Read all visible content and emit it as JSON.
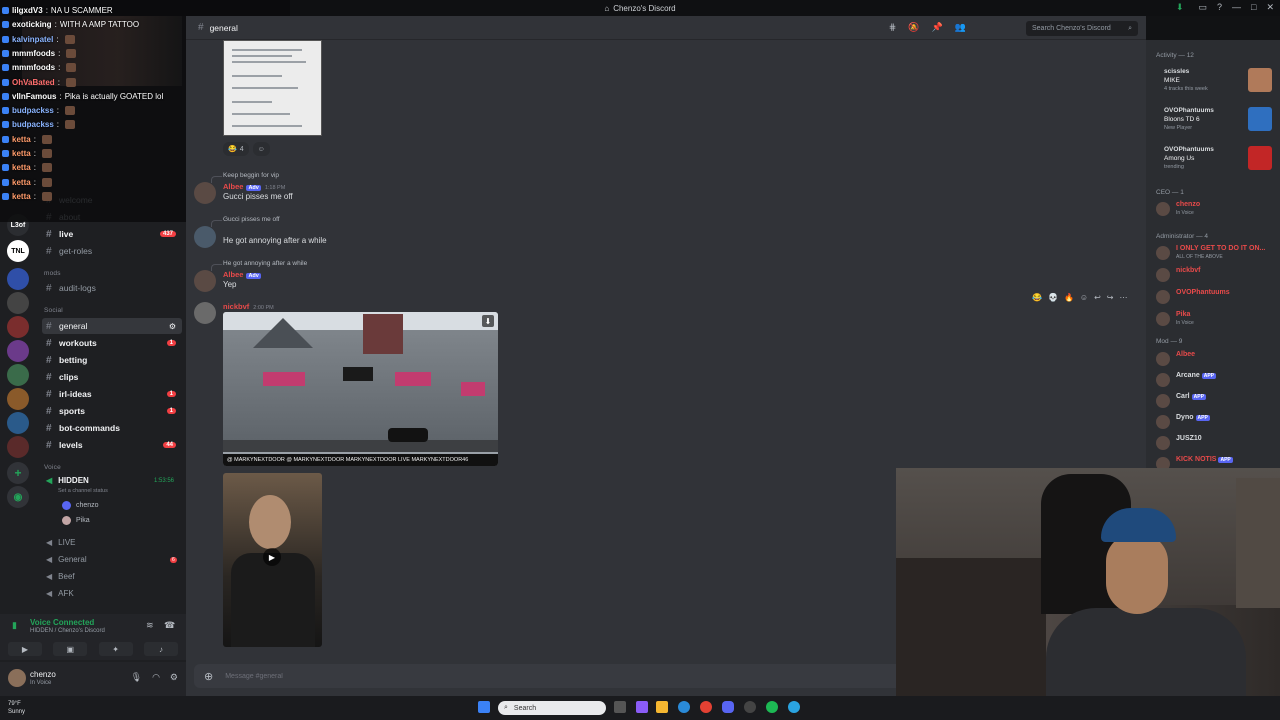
{
  "window": {
    "title": "Chenzo's Discord"
  },
  "stream_chat": [
    {
      "user": "lilgxdV3",
      "text": "NA U SCAMMER",
      "color": "#ffffff"
    },
    {
      "user": "exoticking",
      "text": "WITH A AMP TATTOO",
      "color": "#ffffff"
    },
    {
      "user": "kalvinpatel",
      "text": "",
      "color": "#8ab4ff"
    },
    {
      "user": "mmmfoods",
      "text": "",
      "color": "#ffffff"
    },
    {
      "user": "mmmfoods",
      "text": "",
      "color": "#ffffff"
    },
    {
      "user": "OhVaBated",
      "text": "",
      "color": "#ff6f6f"
    },
    {
      "user": "vllnFamous",
      "text": "Pika is actually GOATED lol",
      "color": "#ffffff"
    },
    {
      "user": "budpackss",
      "text": "",
      "color": "#8ab4ff"
    },
    {
      "user": "budpackss",
      "text": "",
      "color": "#8ab4ff"
    },
    {
      "user": "ketta",
      "text": "",
      "color": "#ff9b6b"
    },
    {
      "user": "ketta",
      "text": "",
      "color": "#ff9b6b"
    },
    {
      "user": "ketta",
      "text": "",
      "color": "#ff9b6b"
    },
    {
      "user": "ketta",
      "text": "",
      "color": "#ff9b6b"
    },
    {
      "user": "ketta",
      "text": "",
      "color": "#ff9b6b"
    }
  ],
  "sidebar": {
    "rail_labels": [
      "L3of",
      "TNL"
    ],
    "category_mods": "mods",
    "category_social": "Social",
    "category_voice": "Voice",
    "channels_top": [
      {
        "name": "welcome",
        "badge": ""
      },
      {
        "name": "about",
        "badge": ""
      },
      {
        "name": "live",
        "badge": "437"
      },
      {
        "name": "get-roles",
        "badge": ""
      }
    ],
    "channel_audit": "audit-logs",
    "channels": [
      {
        "name": "general",
        "badge": "",
        "active": true
      },
      {
        "name": "workouts",
        "badge": "1"
      },
      {
        "name": "betting",
        "badge": ""
      },
      {
        "name": "clips",
        "badge": ""
      },
      {
        "name": "irl-ideas",
        "badge": "1"
      },
      {
        "name": "sports",
        "badge": "1"
      },
      {
        "name": "bot-commands",
        "badge": ""
      },
      {
        "name": "levels",
        "badge": "44"
      }
    ],
    "voice_channel": {
      "name": "HIDDEN",
      "status": "Set a channel status",
      "timer": "1:53:56"
    },
    "voice_users": [
      "chenzo",
      "Pika"
    ],
    "voice_channels": [
      "LIVE",
      "General",
      "Beef",
      "AFK"
    ],
    "general_voice_badge": "6"
  },
  "voice_panel": {
    "status": "Voice Connected",
    "sub": "HIDDEN / Chenzo's Discord"
  },
  "user_panel": {
    "name": "chenzo",
    "status": "In Voice"
  },
  "header": {
    "channel": "general",
    "search_placeholder": "Search Chenzo's Discord"
  },
  "messages": {
    "reaction_count": "4",
    "reply1_text": "Keep beggin for vip",
    "m1_author": "Albee",
    "m1_tag": "Adv",
    "m1_time": "1:18 PM",
    "m1_body": "Gucci pisses me off",
    "reply2_text": "Gucci pisses me off",
    "m2_body": "He got annoying after a while",
    "reply3_text": "He got annoying after a while",
    "m3_author": "Albee",
    "m3_tag": "Adv",
    "m3_body": "Yep",
    "m4_author": "nickbvf",
    "m4_time": "2:00 PM",
    "theater_caption": "@ MARKYNEXTDOOR  @ MARKYNEXTDOOR  MARKYNEXTDOOR LIVE  MARKYNEXTDOOR46"
  },
  "composer": {
    "placeholder": "Message #general"
  },
  "right": {
    "activity_header": "Activity — 12",
    "activities": [
      {
        "user": "scissles",
        "title": "MIKE",
        "sub": "4 tracks this week",
        "color": "#b07a5a"
      },
      {
        "user": "OVOPhantuums",
        "title": "Bloons TD 6",
        "sub": "New Player",
        "color": "#2f6fbf"
      },
      {
        "user": "OVOPhantuums",
        "title": "Among Us",
        "sub": "trending",
        "color": "#c22626"
      }
    ],
    "ceo_header": "CEO — 1",
    "ceo": [
      {
        "name": "chenzo",
        "sub": "In Voice",
        "color": "#e84a4a"
      }
    ],
    "admin_header": "Administrator — 4",
    "admins": [
      {
        "name": "I ONLY GET TO DO IT ON...",
        "sub": "ALL OF THE ABOVE",
        "color": "#e84a4a"
      },
      {
        "name": "nickbvf",
        "sub": "",
        "color": "#e84a4a"
      },
      {
        "name": "OVOPhantuums",
        "sub": "",
        "color": "#e84a4a"
      },
      {
        "name": "Pika",
        "sub": "In Voice",
        "color": "#e84a4a"
      }
    ],
    "mod_header": "Mod — 9",
    "mods": [
      {
        "name": "Albee",
        "sub": "",
        "color": "#e84a4a",
        "app": ""
      },
      {
        "name": "Arcane",
        "sub": "",
        "color": "#dbdee1",
        "app": "APP"
      },
      {
        "name": "Carl",
        "sub": "",
        "color": "#dbdee1",
        "app": "APP"
      },
      {
        "name": "Dyno",
        "sub": "",
        "color": "#dbdee1",
        "app": "APP"
      },
      {
        "name": "JUSZ10",
        "sub": "",
        "color": "#dbdee1",
        "app": ""
      },
      {
        "name": "KICK NOTIS",
        "sub": "",
        "color": "#e84a4a",
        "app": "APP"
      }
    ]
  },
  "taskbar": {
    "temp": "79°F",
    "weather": "Sunny",
    "search": "Search"
  }
}
